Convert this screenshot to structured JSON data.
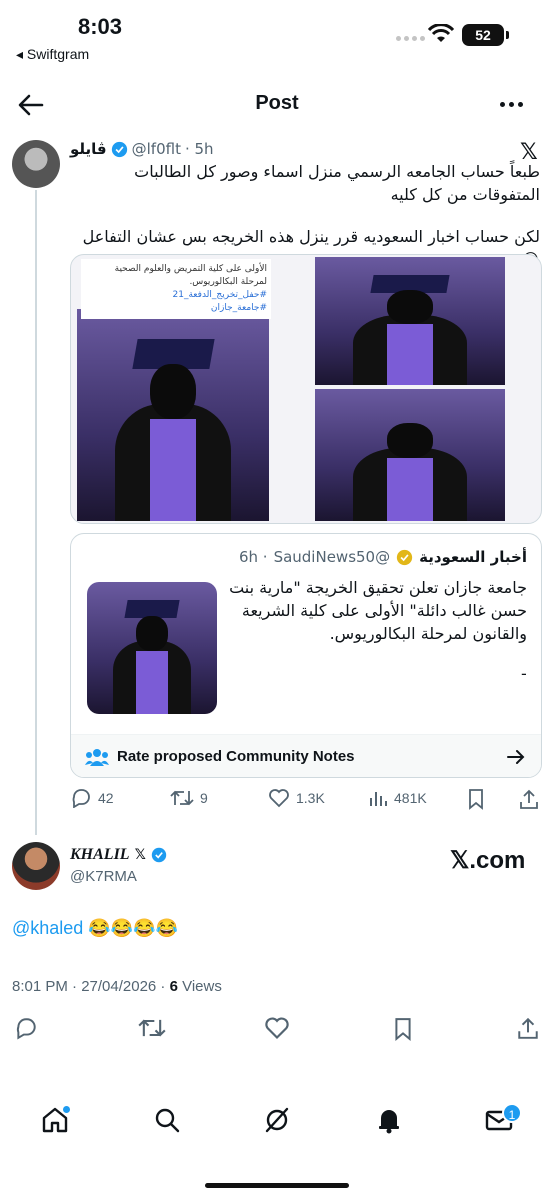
{
  "status_bar": {
    "time": "8:03",
    "back_app": "◂ Swiftgram",
    "battery": "52"
  },
  "header": {
    "title": "Post"
  },
  "post": {
    "name": "ڤايلو",
    "handle": "@lf0flt",
    "time": "· 5h",
    "text_1": "طبعاً حساب الجامعه الرسمي منزل اسماء وصور كل الطالبات المتفوقات من كل كليه",
    "text_2": "لكن حساب اخبار السعوديه قرر ينزل هذه الخريجه بس عشان التفاعل 😂",
    "image_caption": {
      "line_1": "الأولى على كلية التمريض والعلوم الصحية",
      "line_2": "لمرحلة البكالوريوس.",
      "tag_1": "#حفل_تخريج_الدفعة_21",
      "tag_2": "#جامعة_جازان"
    },
    "quote": {
      "name": "أخبار السعودية",
      "handle": "@SaudiNews50",
      "time": "· 6h",
      "text": "جامعة جازان تعلن تحقيق الخريجة \"مارية بنت حسن غالب دائلة\" الأولى على كلية الشريعة والقانون لمرحلة البكالوريوس.",
      "dash": "-",
      "community_notes": "Rate proposed Community Notes"
    },
    "stats": {
      "replies": "42",
      "reposts": "9",
      "likes": "1.3K",
      "views": "481K"
    }
  },
  "reply": {
    "name": "KHALIL",
    "handle": "@K7RMA",
    "brand": "𝕏.com",
    "mention": "@khaled",
    "emojis": " 😂😂😂😂",
    "timestamp": "8:01 PM · 27/04/2026 · ",
    "views_count": "6",
    "views_label": " Views"
  },
  "tabbar": {
    "messages_badge": "1"
  },
  "colors": {
    "accent": "#1d9bf0",
    "text": "#0f1419",
    "muted": "#536471",
    "border": "#cfd9de"
  }
}
